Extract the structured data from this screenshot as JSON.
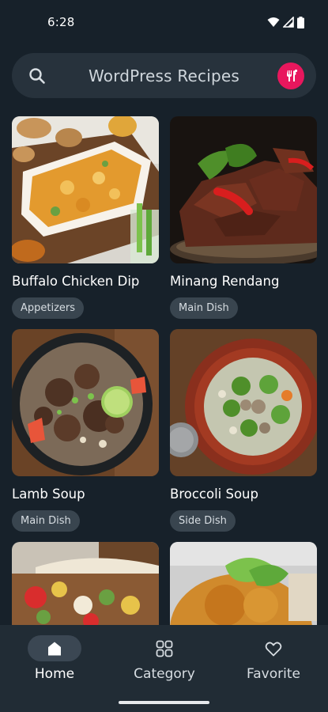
{
  "status_bar": {
    "time": "6:28",
    "icons": [
      "wifi-icon",
      "signal-icon",
      "battery-icon"
    ]
  },
  "search": {
    "title": "WordPress Recipes",
    "icon": "search-icon",
    "badge_icon": "restaurant-icon"
  },
  "recipes": [
    {
      "title": "Buffalo Chicken Dip",
      "category": "Appetizers"
    },
    {
      "title": "Minang Rendang",
      "category": "Main Dish"
    },
    {
      "title": "Lamb Soup",
      "category": "Main Dish"
    },
    {
      "title": "Broccoli Soup",
      "category": "Side Dish"
    },
    {
      "title": "",
      "category": ""
    },
    {
      "title": "",
      "category": ""
    }
  ],
  "bottom_nav": {
    "items": [
      {
        "label": "Home",
        "icon": "home-icon",
        "active": true
      },
      {
        "label": "Category",
        "icon": "grid-icon",
        "active": false
      },
      {
        "label": "Favorite",
        "icon": "heart-icon",
        "active": false
      }
    ]
  },
  "colors": {
    "background": "#17212a",
    "search_bar": "#27323c",
    "accent": "#e8175d",
    "chip": "#39454f",
    "nav_bar": "#212c35"
  }
}
